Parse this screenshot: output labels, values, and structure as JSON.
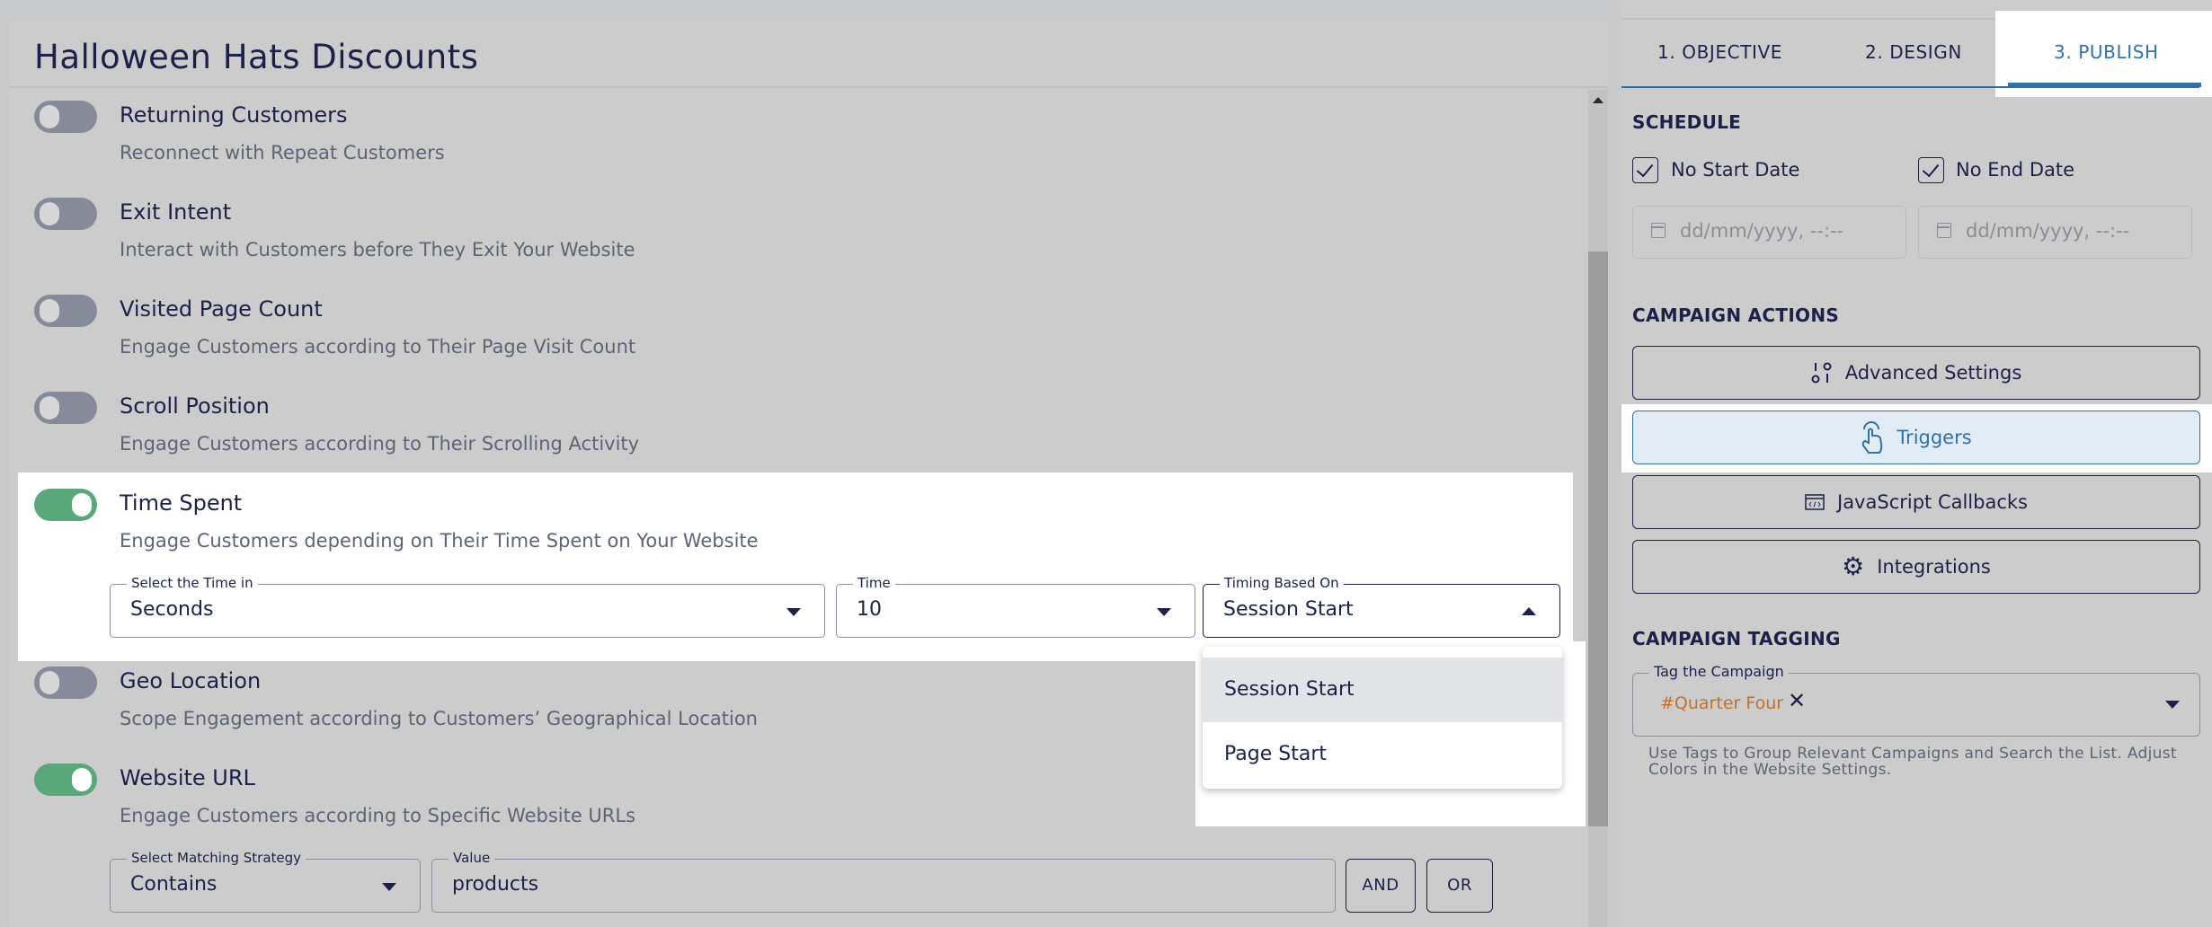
{
  "campaign": {
    "title": "Halloween Hats Discounts"
  },
  "triggers": [
    {
      "name": "Returning Customers",
      "description": "Reconnect with Repeat Customers",
      "enabled": false
    },
    {
      "name": "Exit Intent",
      "description": "Interact with Customers before They Exit Your Website",
      "enabled": false
    },
    {
      "name": "Visited Page Count",
      "description": "Engage Customers according to Their Page Visit Count",
      "enabled": false
    },
    {
      "name": "Scroll Position",
      "description": "Engage Customers according to Their Scrolling Activity",
      "enabled": false
    },
    {
      "name": "Time Spent",
      "description": "Engage Customers depending on Their Time Spent on Your Website",
      "enabled": true
    },
    {
      "name": "Geo Location",
      "description": "Scope Engagement according to Customers’ Geographical Location",
      "enabled": false
    },
    {
      "name": "Website URL",
      "description": "Engage Customers according to Specific Website URLs",
      "enabled": true
    }
  ],
  "time_spent": {
    "unit_label": "Select the Time in",
    "unit_value": "Seconds",
    "time_label": "Time",
    "time_value": "10",
    "timing_label": "Timing Based On",
    "timing_value": "Session Start",
    "timing_options": [
      "Session Start",
      "Page Start"
    ]
  },
  "website_url": {
    "strategy_label": "Select Matching Strategy",
    "strategy_value": "Contains",
    "value_label": "Value",
    "value": "products",
    "and_label": "AND",
    "or_label": "OR"
  },
  "tabs": [
    {
      "label": "1. OBJECTIVE",
      "active": false
    },
    {
      "label": "2. DESIGN",
      "active": false
    },
    {
      "label": "3. PUBLISH",
      "active": true
    }
  ],
  "schedule": {
    "heading": "SCHEDULE",
    "no_start_label": "No Start Date",
    "no_start_checked": true,
    "no_end_label": "No End Date",
    "no_end_checked": true,
    "start_placeholder": "dd/mm/yyyy, --:--",
    "end_placeholder": "dd/mm/yyyy, --:--"
  },
  "actions": {
    "heading": "CAMPAIGN ACTIONS",
    "items": [
      {
        "label": "Advanced Settings",
        "icon": "sliders-icon"
      },
      {
        "label": "Triggers",
        "icon": "pointer-hand-icon",
        "active": true
      },
      {
        "label": "JavaScript Callbacks",
        "icon": "code-window-icon"
      },
      {
        "label": "Integrations",
        "icon": "gear-icon"
      }
    ]
  },
  "tagging": {
    "heading": "CAMPAIGN TAGGING",
    "field_label": "Tag the Campaign",
    "tags": [
      "#Quarter Four"
    ],
    "help_text": "Use Tags to Group Relevant Campaigns and Search the List. Adjust Colors in the Website Settings.",
    "tag_color": "#c0722a"
  },
  "colors": {
    "accent": "#2f72ab",
    "toggle_on": "#5aa77c",
    "text": "#1b2148"
  }
}
